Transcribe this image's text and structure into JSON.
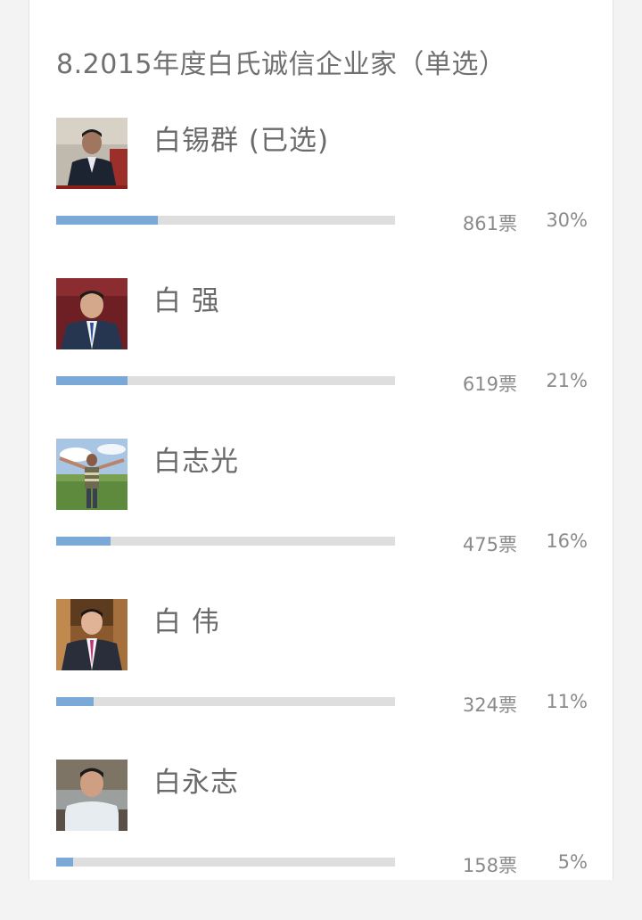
{
  "poll": {
    "title": "8.2015年度白氏诚信企业家（单选）",
    "accent_color": "#7aa9d8",
    "track_color": "#dedede",
    "options": [
      {
        "name": "白锡群 (已选)",
        "votes": "861票",
        "percent": "30%",
        "share": 0.3,
        "selected": true
      },
      {
        "name": "白 强",
        "votes": "619票",
        "percent": "21%",
        "share": 0.21,
        "selected": false
      },
      {
        "name": "白志光",
        "votes": "475票",
        "percent": "16%",
        "share": 0.16,
        "selected": false
      },
      {
        "name": "白 伟",
        "votes": "324票",
        "percent": "11%",
        "share": 0.11,
        "selected": false
      },
      {
        "name": "白永志",
        "votes": "158票",
        "percent": "5%",
        "share": 0.05,
        "selected": false
      }
    ]
  }
}
